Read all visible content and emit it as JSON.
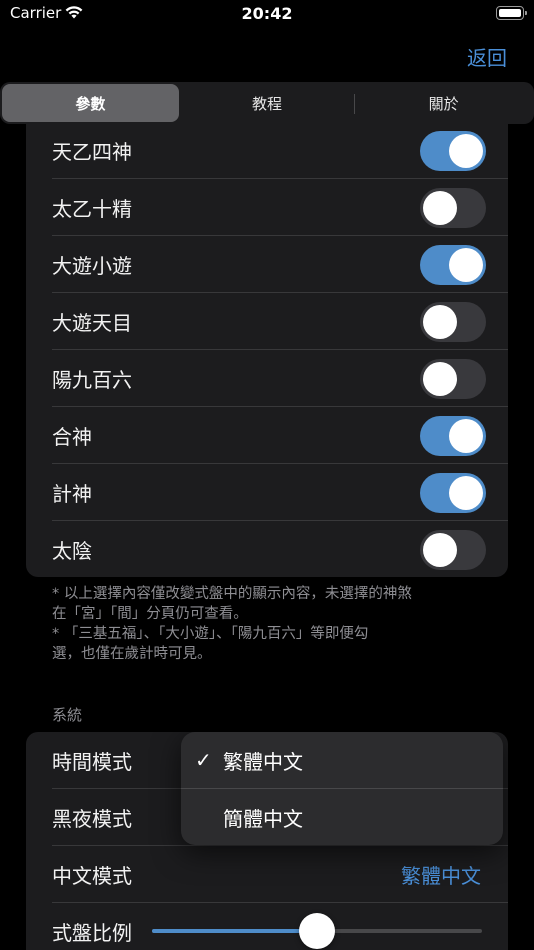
{
  "status": {
    "carrier": "Carrier",
    "time": "20:42"
  },
  "nav": {
    "back_label": "返回"
  },
  "tabs": [
    {
      "label": "參數",
      "selected": true
    },
    {
      "label": "教程",
      "selected": false
    },
    {
      "label": "關於",
      "selected": false
    }
  ],
  "toggles": [
    {
      "label": "天乙四神",
      "on": true
    },
    {
      "label": "太乙十精",
      "on": false
    },
    {
      "label": "大遊小遊",
      "on": true
    },
    {
      "label": "大遊天目",
      "on": false
    },
    {
      "label": "陽九百六",
      "on": false
    },
    {
      "label": "合神",
      "on": true
    },
    {
      "label": "計神",
      "on": true
    },
    {
      "label": "太陰",
      "on": false
    }
  ],
  "footnote": {
    "line1": "* 以上選擇內容僅改變式盤中的顯示內容，未選擇的神煞",
    "line2": "在「宮」「間」分頁仍可查看。",
    "line3": "* 「三基五福」、「大小遊」、「陽九百六」等即便勾",
    "line4": "選，也僅在歲計時可見。"
  },
  "system": {
    "header": "系統",
    "time_mode_label": "時間模式",
    "dark_mode_label": "黑夜模式",
    "chinese_mode_label": "中文模式",
    "chinese_mode_value": "繁體中文",
    "scale_label": "式盤比例",
    "scale_fraction": 0.5
  },
  "menu": {
    "options": [
      {
        "label": "繁體中文",
        "checked": true
      },
      {
        "label": "簡體中文",
        "checked": false
      }
    ],
    "check_glyph": "✓"
  },
  "colors": {
    "accent": "#4e8cc9",
    "link": "#4a8fd8"
  }
}
